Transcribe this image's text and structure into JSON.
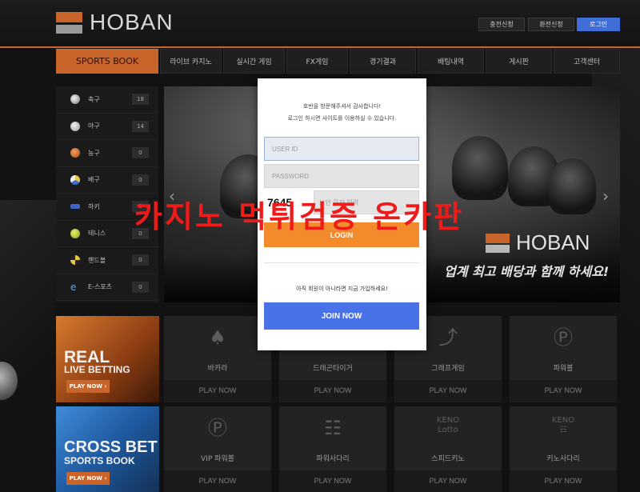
{
  "header": {
    "logo_text": "HOBAN",
    "buttons": {
      "deposit": "충전신청",
      "withdraw": "환전신청",
      "login": "로그인"
    }
  },
  "nav": [
    "SPORTS BOOK",
    "라이브 카지노",
    "실시간 게임",
    "FX게임",
    "경기결과",
    "배팅내역",
    "게시판",
    "고객센터"
  ],
  "sidebar": [
    {
      "label": "축구",
      "count": "18",
      "icon": "soccer-ball-icon",
      "color": "#e0e0e0"
    },
    {
      "label": "야구",
      "count": "14",
      "icon": "baseball-icon",
      "color": "#d7d7d7"
    },
    {
      "label": "농구",
      "count": "0",
      "icon": "basketball-icon",
      "color": "#d9772e"
    },
    {
      "label": "배구",
      "count": "0",
      "icon": "volleyball-icon",
      "color": "#e0c040"
    },
    {
      "label": "하키",
      "count": "0",
      "icon": "hockey-icon",
      "color": "#4b6fd0"
    },
    {
      "label": "테니스",
      "count": "0",
      "icon": "tennis-ball-icon",
      "color": "#c6d44a"
    },
    {
      "label": "핸드볼",
      "count": "0",
      "icon": "handball-icon",
      "color": "#e7c63b"
    },
    {
      "label": "E-스포츠",
      "count": "0",
      "icon": "esports-icon",
      "color": "#5aa3e8"
    }
  ],
  "banner": {
    "logo_text": "HOBAN",
    "slogan": "업계 최고 배당과 함께 하세요!"
  },
  "promos": [
    {
      "title": "REAL",
      "subtitle": "LIVE BETTING",
      "cta": "PLAY NOW ›"
    },
    {
      "title": "CROSS BET",
      "subtitle": "SPORTS BOOK",
      "cta": "PLAY NOW ›"
    }
  ],
  "games": [
    {
      "name": "바카라",
      "cta": "PLAY NOW",
      "icon": "card-icon"
    },
    {
      "name": "드래곤타이거",
      "cta": "PLAY NOW",
      "icon": "dragon-tiger-icon"
    },
    {
      "name": "그래프게임",
      "cta": "PLAY NOW",
      "icon": "graph-icon"
    },
    {
      "name": "파워볼",
      "cta": "PLAY NOW",
      "icon": "powerball-icon"
    },
    {
      "name": "VIP 파워볼",
      "cta": "PLAY NOW",
      "icon": "powerball-icon"
    },
    {
      "name": "파워사다리",
      "cta": "PLAY NOW",
      "icon": "ladder-icon"
    },
    {
      "name": "스피드키노",
      "cta": "PLAY NOW",
      "icon": "keno-lotto-icon"
    },
    {
      "name": "키노사다리",
      "cta": "PLAY NOW",
      "icon": "keno-ladder-icon"
    }
  ],
  "overlay_text": "카지노 먹튀검증 온카판",
  "modal": {
    "welcome": "호반을 방문해주셔서 감사합니다!",
    "subtitle": "로그인 하시면 사이트를 이용하실 수 있습니다.",
    "userid_placeholder": "USER ID",
    "password_placeholder": "PASSWORD",
    "captcha_code": "7645",
    "captcha_placeholder": "보안 문자 입력",
    "login_label": "LOGIN",
    "join_note": "아직 회원이 아니라면 지금 가입하세요!",
    "join_label": "JOIN NOW"
  },
  "colors": {
    "accent": "#c9652a",
    "login_orange": "#f38a2c",
    "join_blue": "#4a72e8",
    "overlay_red": "#ee1b1b"
  }
}
